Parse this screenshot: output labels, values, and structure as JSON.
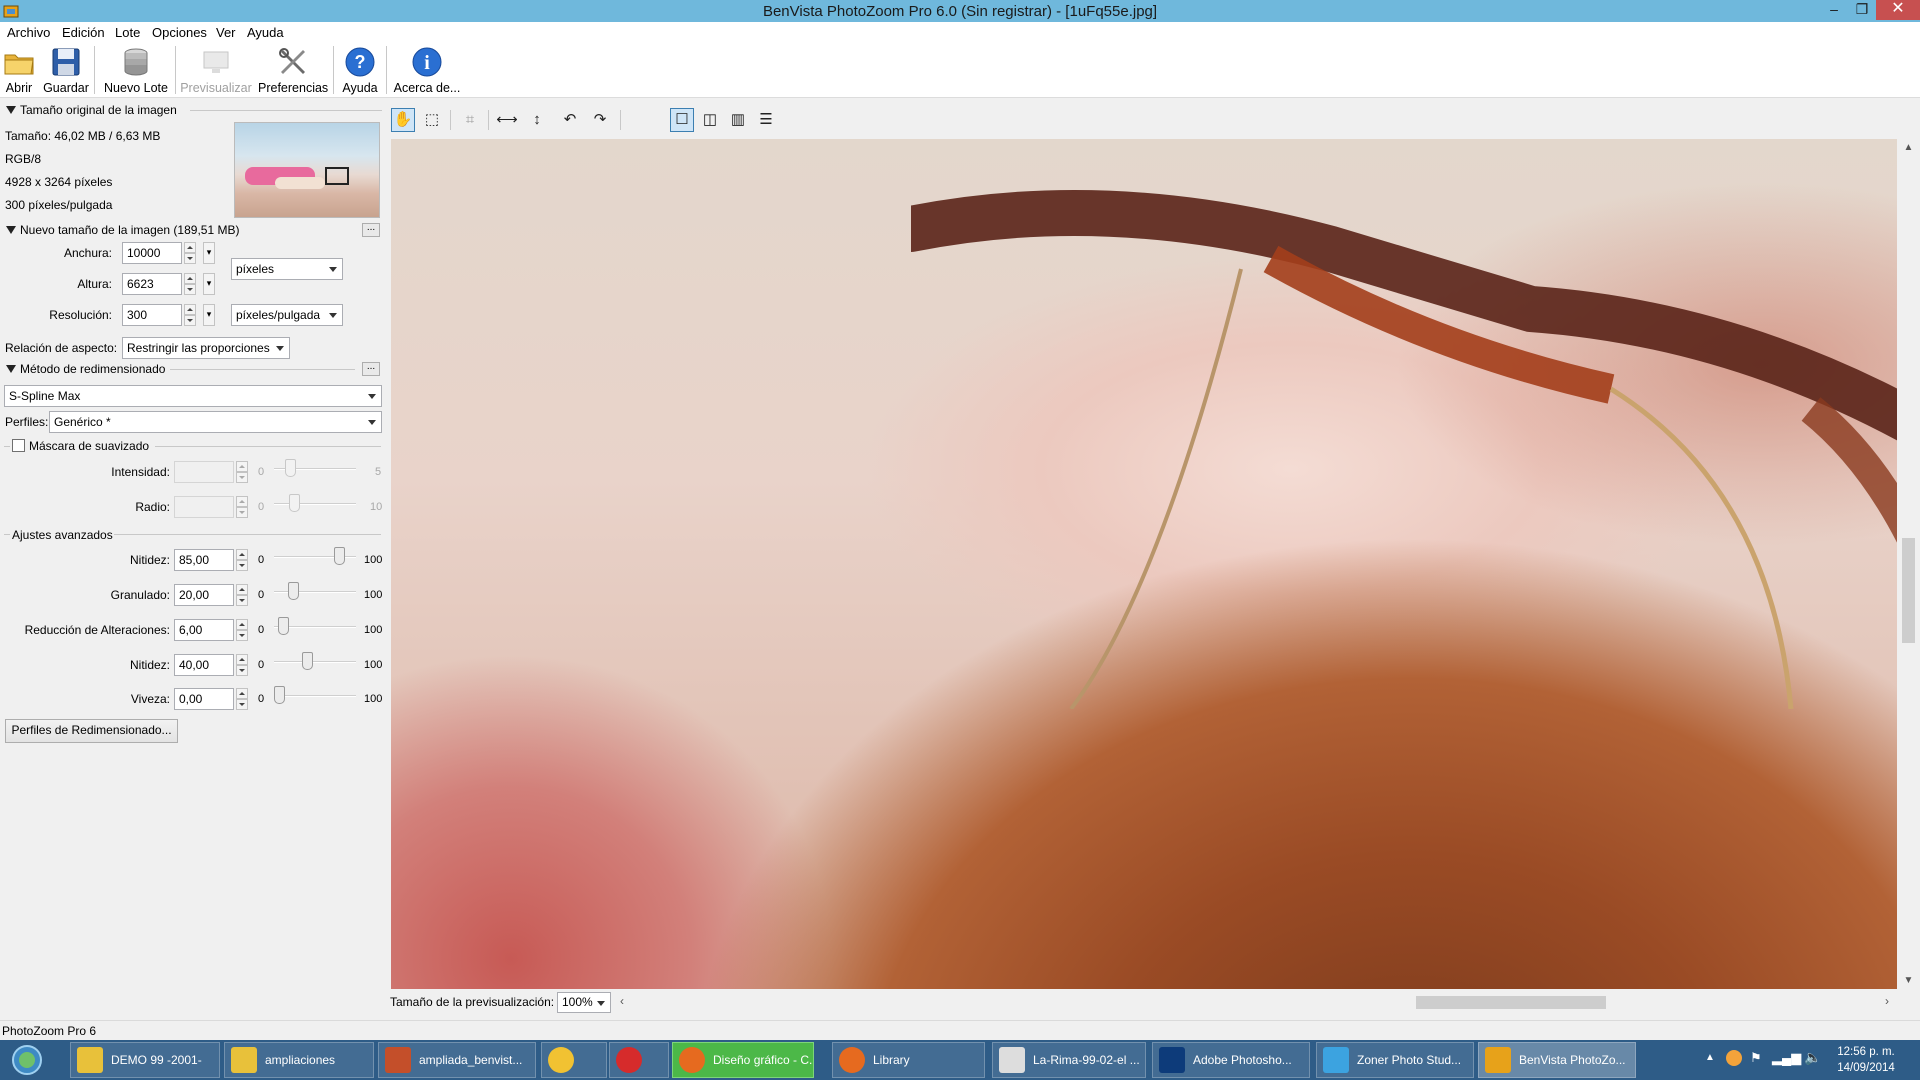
{
  "window": {
    "title": "BenVista PhotoZoom Pro 6.0 (Sin registrar) - [1uFq55e.jpg]",
    "min_glyph": "–",
    "max_glyph": "❐",
    "close_glyph": "✕"
  },
  "menu": [
    "Archivo",
    "Edición",
    "Lote",
    "Opciones",
    "Ver",
    "Ayuda"
  ],
  "toolbar": {
    "open": "Abrir",
    "save": "Guardar",
    "batch": "Nuevo Lote",
    "preview": "Previsualizar",
    "prefs": "Preferencias",
    "help": "Ayuda",
    "about": "Acerca de..."
  },
  "original": {
    "title": "Tamaño original de la imagen",
    "size": "Tamaño: 46,02 MB / 6,63 MB",
    "mode": "RGB/8",
    "pixels": "4928 x 3264 píxeles",
    "resolution": "300 píxeles/pulgada"
  },
  "newsize": {
    "title": "Nuevo tamaño de la imagen (189,51 MB)",
    "width_label": "Anchura:",
    "width_value": "10000",
    "height_label": "Altura:",
    "height_value": "6623",
    "res_label": "Resolución:",
    "res_value": "300",
    "unit": "píxeles",
    "res_unit": "píxeles/pulgada",
    "aspect_label": "Relación de aspecto:",
    "aspect_value": "Restringir las proporciones",
    "dots": "..."
  },
  "method": {
    "title": "Método de redimensionado",
    "algorithm": "S-Spline Max",
    "profiles_label": "Perfiles:",
    "profile_value": "Genérico *"
  },
  "unsharp": {
    "title": "Máscara de suavizado",
    "intensity_label": "Intensidad:",
    "intensity_min": "0",
    "intensity_max": "5",
    "radius_label": "Radio:",
    "radius_min": "0",
    "radius_max": "10"
  },
  "advanced": {
    "title": "Ajustes avanzados",
    "rows": [
      {
        "label": "Nitidez:",
        "value": "85,00",
        "min": "0",
        "max": "100",
        "pos": 85
      },
      {
        "label": "Granulado:",
        "value": "20,00",
        "min": "0",
        "max": "100",
        "pos": 20
      },
      {
        "label": "Reducción de Alteraciones:",
        "value": "6,00",
        "min": "0",
        "max": "100",
        "pos": 6
      },
      {
        "label": "Nitidez:",
        "value": "40,00",
        "min": "0",
        "max": "100",
        "pos": 40
      },
      {
        "label": "Viveza:",
        "value": "0,00",
        "min": "0",
        "max": "100",
        "pos": 0
      }
    ],
    "profiles_button": "Perfiles de Redimensionado..."
  },
  "preview": {
    "size_label": "Tamaño de la previsualización:",
    "zoom": "100%"
  },
  "status": "PhotoZoom Pro 6",
  "taskbar": {
    "tasks": [
      "DEMO 99 -2001-",
      "ampliaciones",
      "ampliada_benvist...",
      "",
      "",
      "Diseño gráfico - C...",
      "Library",
      "La-Rima-99-02-el ...",
      "Adobe Photosho...",
      "Zoner Photo Stud...",
      "BenVista PhotoZo..."
    ],
    "time": "12:56 p. m.",
    "date": "14/09/2014"
  },
  "colors": {
    "titlebar": "#6fb8dc",
    "taskbar": "#2e5c87",
    "active_task_green": "#4cb848"
  }
}
